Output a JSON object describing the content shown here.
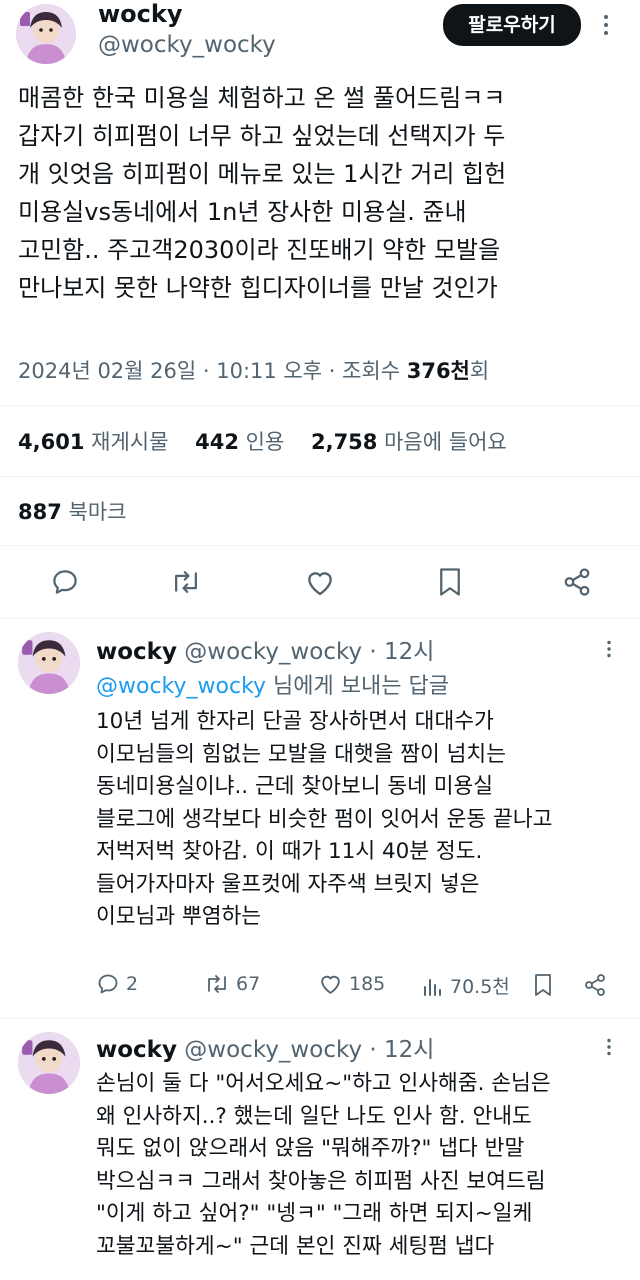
{
  "main_tweet": {
    "display_name": "wocky",
    "handle": "@wocky_wocky",
    "follow_label": "팔로우하기",
    "text": "매콤한 한국 미용실 체험하고 온 썰 풀어드림ㅋㅋ\n갑자기 히피펌이 너무 하고 싶었는데 선택지가 두\n개 잇엇음 히피펌이 메뉴로 있는 1시간 거리 힙헌\n미용실vs동네에서 1n년 장사한 미용실. 쥰내\n고민함.. 주고객2030이라 진또배기 약한 모발을\n만나보지 못한 나약한 힙디자이너를 만날 것인가",
    "timestamp": "2024년 02월 26일 · 10:11 오후 · 조회수 ",
    "views_count": "376천",
    "views_suffix": "회",
    "retweets_count": "4,601",
    "retweets_label": "재게시물",
    "quotes_count": "442",
    "quotes_label": "인용",
    "likes_count": "2,758",
    "likes_label": "마음에 들어요",
    "bookmarks_count": "887",
    "bookmarks_label": "북마크"
  },
  "replies": [
    {
      "display_name": "wocky",
      "handle": "@wocky_wocky",
      "time": " · 12시",
      "replying_to": "@wocky_wocky",
      "replying_suffix": " 님에게 보내는 답글",
      "text": "10년 넘게 한자리 단골 장사하면서 대대수가\n이모님들의 힘없는 모발을 대햇을 짬이 넘치는\n동네미용실이냐.. 근데 찾아보니 동네 미용실\n블로그에 생각보다 비슷한 펌이 잇어서 운동 끝나고\n저벅저벅 찾아감. 이 때가 11시 40분 정도.\n들어가자마자 울프컷에 자주색 브릿지 넣은\n이모님과 뿌염하는",
      "metrics": {
        "replies": "2",
        "retweets": "67",
        "likes": "185",
        "views": "70.5천"
      }
    },
    {
      "display_name": "wocky",
      "handle": "@wocky_wocky",
      "time": " · 12시",
      "text": "손님이 둘 다 \"어서오세요~\"하고 인사해줌. 손님은\n왜 인사하지..? 했는데 일단 나도 인사 함. 안내도\n뭐도 없이 앉으래서 앉음 \"뭐해주까?\" 냅다 반말\n박으심ㅋㅋ 그래서 찾아놓은 히피펌 사진 보여드림\n\"이게 하고 싶어?\" \"넹ㅋ\" \"그래 하면 되지~일케\n꼬불꼬불하게~\" 근데 본인 진짜 세팅펌 냅다"
    }
  ],
  "colors": {
    "text": "#0f1419",
    "secondary": "#536471",
    "link": "#1d9bf0",
    "divider": "#eff3f4"
  }
}
